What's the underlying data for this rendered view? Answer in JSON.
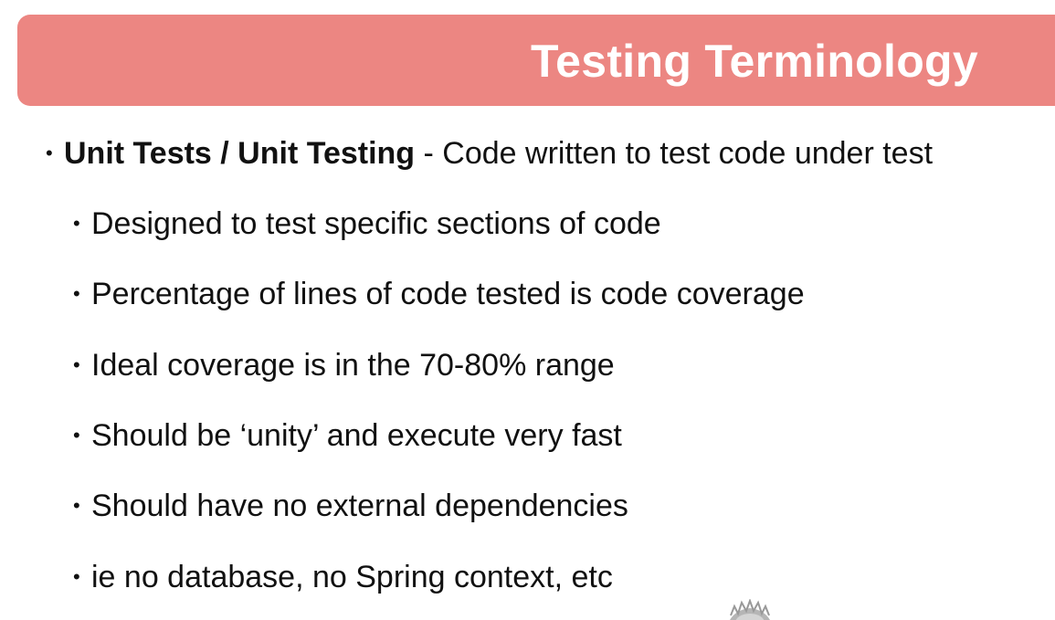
{
  "slide": {
    "title": "Testing Terminology",
    "main_bullet": {
      "term": "Unit Tests / Unit Testing",
      "description": " - Code written to test code under test"
    },
    "sub_bullets": [
      "Designed to test specific sections of code",
      "Percentage of lines of code tested is code coverage",
      "Ideal coverage is in the 70-80% range",
      "Should be ‘unity’ and execute very fast",
      "Should have no external dependencies",
      "ie no database, no Spring context, etc"
    ]
  },
  "colors": {
    "title_bar": "#ec8682",
    "title_text": "#ffffff",
    "body_text": "#111111"
  }
}
